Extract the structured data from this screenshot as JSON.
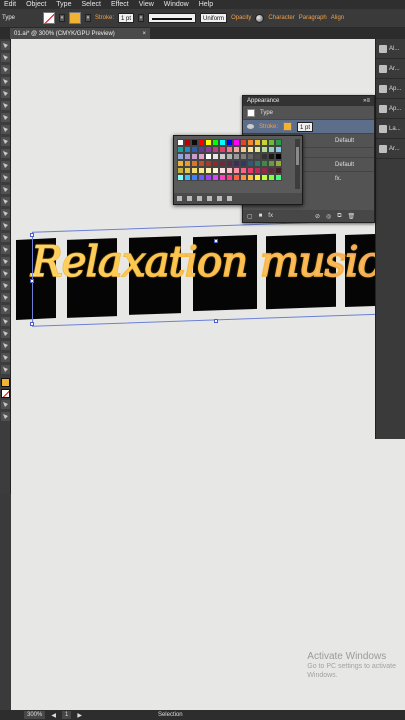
{
  "menubar": {
    "items": [
      "Edit",
      "Object",
      "Type",
      "Select",
      "Effect",
      "View",
      "Window",
      "Help"
    ]
  },
  "control": {
    "left_label": "Type",
    "stroke_label": "Stroke:",
    "stroke_weight": "1 pt",
    "profile": "Uniform",
    "opacity_label": "Opacity",
    "character_label": "Character",
    "paragraph_label": "Paragraph",
    "align_label": "Align"
  },
  "document": {
    "tab_title": "01.ai* @ 300% (CMYK/GPU Preview)",
    "close_glyph": "×"
  },
  "artwork": {
    "text": "Relaxation music"
  },
  "appearance": {
    "title": "Appearance",
    "type_row": "Type",
    "stroke_label": "Stroke:",
    "stroke_weight": "1 pt",
    "opacity_row_1": "Default",
    "opacity_row_2": "Default",
    "fx_label": "fx",
    "footer_partial": "fx."
  },
  "swatch_colors": [
    "#ffffff",
    "#c00000",
    "#0a0a0a",
    "#ff0000",
    "#ffff00",
    "#00ff00",
    "#00ffff",
    "#0000ff",
    "#ff00ff",
    "#e8442c",
    "#f08a2c",
    "#f2c12e",
    "#c8d436",
    "#6fb83a",
    "#2d9c4a",
    "#1ea39a",
    "#1f8bc7",
    "#2e5fae",
    "#5a3f99",
    "#8e3a9b",
    "#c23a88",
    "#e03d6a",
    "#f27a8c",
    "#f4a6a0",
    "#f7c98e",
    "#f7e39a",
    "#dfe89a",
    "#b2db9a",
    "#8fd1c0",
    "#8cc6e6",
    "#8fa8d8",
    "#a89ad0",
    "#c79fcf",
    "#e39fc5",
    "#ffffff",
    "#e6e6e6",
    "#cccccc",
    "#b3b3b3",
    "#999999",
    "#808080",
    "#666666",
    "#4d4d4d",
    "#333333",
    "#1a1a1a",
    "#000000",
    "#f2b233",
    "#e89b2c",
    "#d9762b",
    "#c0502a",
    "#a43a2c",
    "#8a2c2c",
    "#6e2a3a",
    "#5a2c4a",
    "#3e2c5a",
    "#2c3a6a",
    "#2c5a7a",
    "#2c7a6a",
    "#3a8a4a",
    "#6a9a3a",
    "#9aa83a",
    "#c8b23a",
    "#e0c84a",
    "#f2dc6a",
    "#f7e88a",
    "#fff2b0",
    "#fff8d8",
    "#ffe0e0",
    "#ffc0c8",
    "#ff90a8",
    "#ff6088",
    "#e83a6a",
    "#c02a5a",
    "#902a4a",
    "#602a3a",
    "#402020",
    "#80ffff",
    "#40c0ff",
    "#4080ff",
    "#6060ff",
    "#a040ff",
    "#e040ff",
    "#ff40c0",
    "#ff4080",
    "#ff6040",
    "#ff9040",
    "#ffc040",
    "#fff040",
    "#c0ff40",
    "#80ff40",
    "#40ff80"
  ],
  "canvas": {
    "background": "#e7e8e6"
  },
  "watermark": {
    "title": "Activate Windows",
    "line1": "Go to PC settings to activate",
    "line2": "Windows."
  },
  "status": {
    "zoom": "300%",
    "page": "1",
    "tool": "Selection"
  },
  "dock": {
    "items": [
      "Al...",
      "Ar...",
      "Ap...",
      "Ap...",
      "La...",
      "Ar..."
    ]
  }
}
